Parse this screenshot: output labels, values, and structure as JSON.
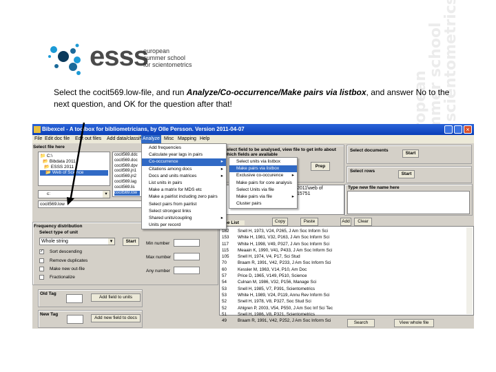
{
  "logo": {
    "wordmark": "esss",
    "tagline": [
      "european",
      "summer school",
      "for scientometrics"
    ],
    "colors": [
      "#1b9ad6",
      "#0b3a5c"
    ]
  },
  "watermark": "european\nsummer school\nfor scientometrics",
  "caption": {
    "before": "Select the cocit569.low-file,  and run ",
    "emph": "Analyze/Co-occurrence/Make pairs via listbox",
    "after": ", and answer No to the next question, and OK for the question after that!"
  },
  "window": {
    "title": "Bibexcel -  A toolbox for bibliometricians, by Olle Persson. Version 2011-04-07",
    "menu": [
      "File",
      "Edit doc file",
      "Edit out files",
      "Add data/classify",
      "Analyze",
      "Misc",
      "Mapping",
      "Help"
    ],
    "select_file_label": "Select file here",
    "folders": [
      "C:\\",
      "Bibdata 2011",
      "ESSS 2011",
      "Web of Science"
    ],
    "files": [
      "cocit569.ddc",
      "cocit569.doc",
      "cocit569.dpv",
      "cocit569.jn1",
      "cocit569.jn2",
      "cocit569.lag",
      "cocit569.lis",
      "cocit569.low"
    ],
    "drive": "c:",
    "filename": "cocit569.low",
    "field_label": "Select field to be analysed, view file to get info about which fields are available",
    "prep": "Prep",
    "info_text": "2011\\web of\n15751",
    "select_documents": "Select documents",
    "select_rows": "Select rows",
    "start": "Start",
    "new_file_label": "Type new file name here",
    "list_label": "The List",
    "copy": "Copy",
    "paste": "Paste",
    "add": "Add",
    "clear": "Clear",
    "freq": {
      "title": "Frequency distribution",
      "unit_label": "Select type of unit",
      "unit": "Whole string",
      "start": "Start",
      "options": [
        {
          "label": "Sort descending",
          "checked": true
        },
        {
          "label": "Remove duplicates",
          "checked": false
        },
        {
          "label": "Make new out-file",
          "checked": false
        },
        {
          "label": "Fractionalize",
          "checked": false
        }
      ],
      "min": "Min number",
      "max": "Max number",
      "any": "Any number"
    },
    "old_tag": "Old Tag",
    "add_field_units": "Add field to units",
    "new_tag": "New Tag",
    "add_field_docs": "Add new field to docs",
    "search": "Search",
    "view_whole": "View whole file",
    "list": [
      [
        "182",
        "Snell H, 1973, V24, P265, J Am Soc Inform Sci"
      ],
      [
        "153",
        "White H, 1981, V32, P163, J Am Soc Inform Sci"
      ],
      [
        "117",
        "White H, 1998, V49, P327, J Am Soc Inform Sci"
      ],
      [
        "115",
        "Meaain K, 1990, V41, P433, J Am Soc Inform Sci"
      ],
      [
        "105",
        "Snell H, 1974, V4, P17, Sci Stud"
      ],
      [
        "70",
        "Braam R, 1991, V42, P233, J Am Soc Inform Sci"
      ],
      [
        "60",
        "Kessler M, 1963, V14, P10, Am Doc"
      ],
      [
        "57",
        "Price D, 1965, V149, P510, Science"
      ],
      [
        "54",
        "Culnan M, 1986, V32, P156, Manage Sci"
      ],
      [
        "53",
        "Snell H, 1985, V7, P391, Scientometrics"
      ],
      [
        "53",
        "White H, 1989, V24, P119, Annu Rev Inform Sci"
      ],
      [
        "52",
        "Snell H, 1978, V8, P327, Soc Stud Sci"
      ],
      [
        "52",
        "Ahlgren P, 2003, V54, P550, J Am Soc Inf Sci Tec"
      ],
      [
        "51",
        "Snell H, 1986, V8, P321, Scientometrics"
      ],
      [
        "49",
        "Braam R, 1991, V42, P252, J Am Soc Inform Sci"
      ]
    ],
    "analyze_menu": [
      {
        "label": "Add frequencies"
      },
      {
        "label": "Calculate year lags in pairs"
      },
      {
        "label": "Co-occurrence",
        "sub": true,
        "hl": true
      },
      {
        "label": "Citations among docs",
        "sub": true
      },
      {
        "label": "Docs and units matrices",
        "sub": true
      },
      {
        "label": "List units in pairs"
      },
      {
        "label": "Make a matrix for MDS etc"
      },
      {
        "label": "Make a pairlist including zero pairs"
      },
      {
        "label": "Select pairs from pairlist"
      },
      {
        "label": "Select strongest links"
      },
      {
        "label": "Shared units/coupling",
        "sub": true
      },
      {
        "label": "Units per record"
      }
    ],
    "cooc_menu": [
      {
        "label": "Select units via listbox"
      },
      {
        "label": "Make pairs via listbox",
        "hl": true
      },
      {
        "label": "Exclusive co-occurence",
        "sub": true
      },
      {
        "label": "Make pairs for core analysis"
      },
      {
        "label": "Select Units via file"
      },
      {
        "label": "Make pairs via file",
        "sub": true
      },
      {
        "label": "Cluster pairs"
      }
    ]
  }
}
